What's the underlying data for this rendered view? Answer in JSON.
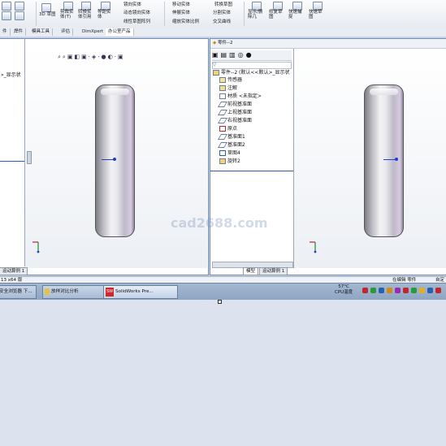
{
  "ribbon": {
    "items": [
      {
        "label": "3D 草图"
      },
      {
        "label": "剪裁实\n体(T)"
      },
      {
        "label": "转换实\n体引用"
      },
      {
        "label": "等距实\n体"
      },
      {
        "label": "线性草图阵列"
      },
      {
        "label": "动态镜向实体"
      },
      {
        "label": "镜向实体"
      },
      {
        "label": "移动实体"
      },
      {
        "label": "伸展实体"
      },
      {
        "label": "缩放实体比例"
      },
      {
        "label": "分割实体"
      },
      {
        "label": "交叉曲线"
      },
      {
        "label": "显示/删\n除几"
      },
      {
        "label": "修复草\n图"
      },
      {
        "label": "快速捕\n捉"
      },
      {
        "label": "快速草\n图"
      }
    ]
  },
  "tabs": [
    "件",
    "焊件",
    "模具工具",
    "评估",
    "DimXpert",
    "办公室产品"
  ],
  "left_pane": {
    "tree_label": "»_显示状",
    "bottom_tab": "运动算例 1",
    "status_left": "13 x64 版"
  },
  "right_pane": {
    "title": "零件--2",
    "tree_root": "零件--2 (默认<<默认>_显示状",
    "tree_items": [
      "传感器",
      "注解",
      "材质 <未指定>",
      "前视基准面",
      "上视基准面",
      "右视基准面",
      "原点",
      "基准面1",
      "基准面2",
      "草图4",
      "旋转2"
    ],
    "bottom_tabs": [
      "模型",
      "运动算例 1"
    ]
  },
  "watermark": "cad2688.com",
  "status": {
    "left": "13 x64 版",
    "editing": "在编辑 零件",
    "custom": "自定"
  },
  "taskbar": {
    "items": [
      "安全浏览器 下...",
      "放样对比分析",
      "SolidWorks Pre..."
    ],
    "temp": "57°C",
    "cpu": "CPU温度"
  },
  "colors": {
    "accent": "#2a5fb0",
    "taskbar": "#9ab0cc",
    "axis_red": "#c0262a",
    "axis_green": "#1b8a2a",
    "axis_blue": "#1f3fd1"
  }
}
